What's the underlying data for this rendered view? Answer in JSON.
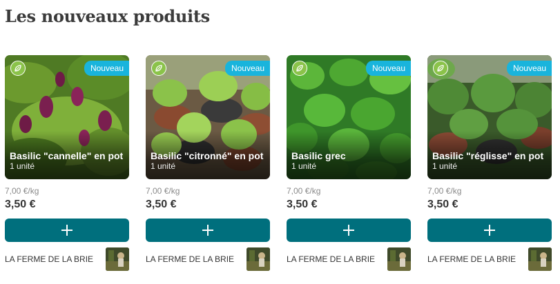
{
  "section": {
    "title": "Les nouveaux produits"
  },
  "colors": {
    "accent": "#006f7d",
    "new_badge": "#19b4dc",
    "bio_badge": "#8bc34a"
  },
  "products": [
    {
      "name": "Basilic \"cannelle\" en pot",
      "unit": "1 unité",
      "price_per_kg": "7,00 €/kg",
      "price": "3,50 €",
      "badge": "Nouveau",
      "seller": "LA FERME DE LA BRIE",
      "bio_icon": "leaf-icon",
      "add_icon": "plus-icon"
    },
    {
      "name": "Basilic \"citronné\" en pot",
      "unit": "1 unité",
      "price_per_kg": "7,00 €/kg",
      "price": "3,50 €",
      "badge": "Nouveau",
      "seller": "LA FERME DE LA BRIE",
      "bio_icon": "leaf-icon",
      "add_icon": "plus-icon"
    },
    {
      "name": "Basilic grec",
      "unit": "1 unité",
      "price_per_kg": "7,00 €/kg",
      "price": "3,50 €",
      "badge": "Nouveau",
      "seller": "LA FERME DE LA BRIE",
      "bio_icon": "leaf-icon",
      "add_icon": "plus-icon"
    },
    {
      "name": "Basilic \"réglisse\" en pot",
      "unit": "1 unité",
      "price_per_kg": "7,00 €/kg",
      "price": "3,50 €",
      "badge": "Nouveau",
      "seller": "LA FERME DE LA BRIE",
      "bio_icon": "leaf-icon",
      "add_icon": "plus-icon"
    }
  ]
}
